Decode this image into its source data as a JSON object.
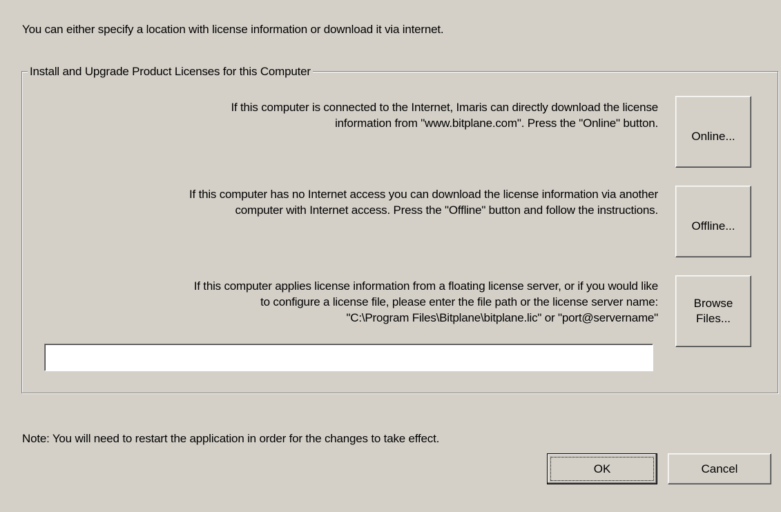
{
  "intro_text": "You can either specify a location with license information or download it via internet.",
  "group": {
    "title": "Install and Upgrade Product Licenses for this Computer",
    "online": {
      "lines": [
        "If this computer is connected to the Internet, Imaris can directly download the license",
        "information from \"www.bitplane.com\". Press the \"Online\" button."
      ],
      "button_label": "Online..."
    },
    "offline": {
      "lines": [
        "If this computer has no Internet access you can download the license information via another",
        "computer with Internet access. Press the \"Offline\" button and follow the instructions."
      ],
      "button_label": "Offline..."
    },
    "license_file": {
      "lines": [
        "If this computer applies license information from a floating license server, or if you would like",
        "to configure a license file, please enter the file path or the license server name:",
        "\"C:\\Program Files\\Bitplane\\bitplane.lic\" or \"port@servername\""
      ],
      "button_lines": [
        "Browse",
        "Files..."
      ],
      "input_value": "",
      "input_placeholder": ""
    }
  },
  "note_text": "Note: You will need to restart the application in order for the changes to take effect.",
  "buttons": {
    "ok": "OK",
    "cancel": "Cancel"
  }
}
